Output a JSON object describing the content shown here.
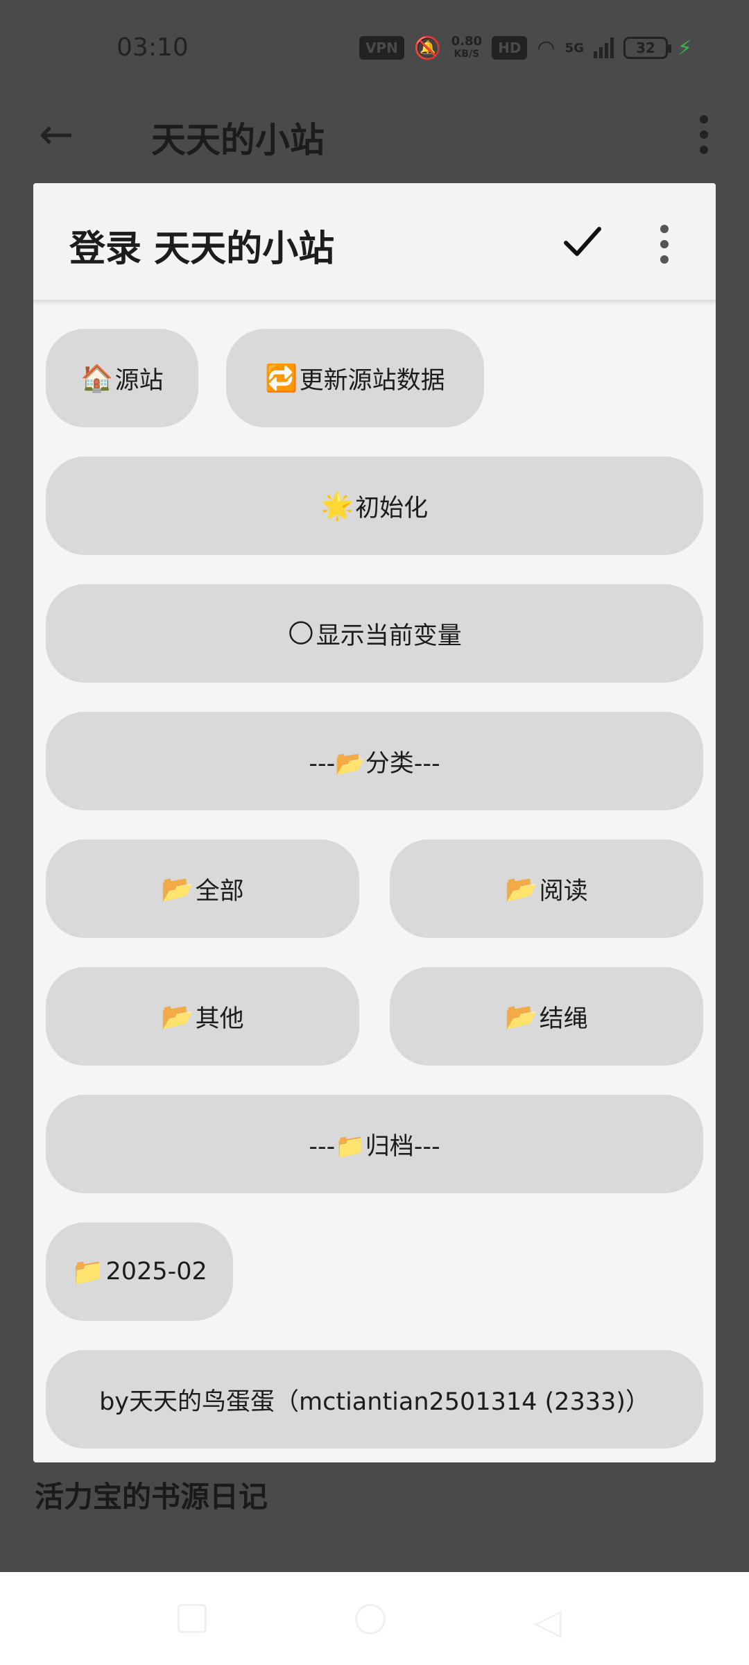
{
  "status_bar": {
    "time": "03:10",
    "vpn": "VPN",
    "mute_icon": "bell-off-icon",
    "speed_value": "0.80",
    "speed_unit": "KB/S",
    "hd": "HD",
    "network": "5G",
    "battery": "32"
  },
  "app_bar": {
    "title": "天天的小站"
  },
  "background": {
    "subtitle": "活力宝的书源日记"
  },
  "dialog": {
    "title": "登录 天天的小站",
    "buttons": {
      "source": {
        "emoji": "🏠",
        "label": "源站"
      },
      "update": {
        "emoji": "🔁",
        "label": "更新源站数据"
      },
      "init": {
        "emoji": "🌟",
        "label": "初始化"
      },
      "vars": {
        "emoji": "🌕",
        "label": "显示当前变量"
      },
      "category": {
        "label": "---📂分类---"
      },
      "all": {
        "emoji": "📂",
        "label": "全部"
      },
      "read": {
        "emoji": "📂",
        "label": "阅读"
      },
      "other": {
        "emoji": "📂",
        "label": "其他"
      },
      "knot": {
        "emoji": "📂",
        "label": "结绳"
      },
      "archive": {
        "label": "---📁归档---"
      },
      "month": {
        "emoji": "📁",
        "label": "2025-02"
      },
      "author": {
        "label": "by天天的鸟蛋蛋（mctiantian2501314 (2333)）"
      }
    }
  }
}
